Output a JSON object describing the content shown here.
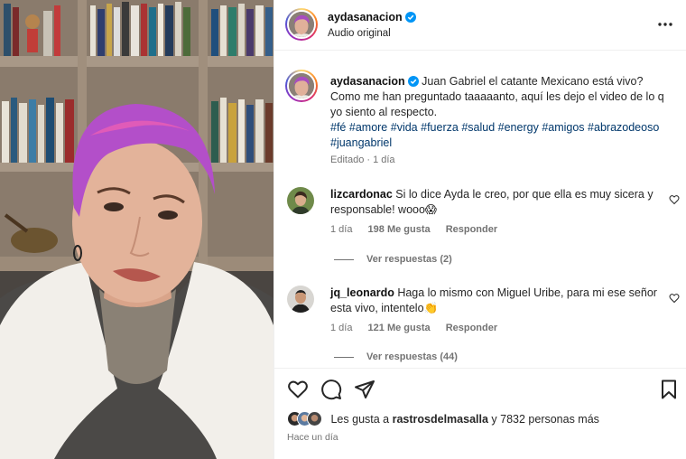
{
  "header": {
    "username": "aydasanacion",
    "audio_label": "Audio original",
    "icons": {
      "verified": "verified-badge-icon",
      "more": "more-options-icon"
    }
  },
  "caption": {
    "username": "aydasanacion",
    "text": "Juan Gabriel el catante Mexicano está vivo? Como me han preguntado taaaaanto, aquí les dejo el video de lo q yo siento al respecto.",
    "hashtags": [
      "#fé",
      "#amore",
      "#vida",
      "#fuerza",
      "#salud",
      "#energy",
      "#amigos",
      "#abrazodeoso",
      "#juangabriel"
    ],
    "meta": "Editado · 1 día"
  },
  "comments": [
    {
      "username": "lizcardonac",
      "text": "Si lo dice Ayda le creo, por que ella es muy sicera y responsable! wooo😱",
      "time": "1 día",
      "likes": "198 Me gusta",
      "reply_label": "Responder",
      "view_replies": "Ver respuestas (2)"
    },
    {
      "username": "jq_leonardo",
      "text": "Haga lo mismo con Miguel Uribe, para mi ese señor esta vivo, intentelo👏",
      "time": "1 día",
      "likes": "121 Me gusta",
      "reply_label": "Responder",
      "view_replies": "Ver respuestas (44)"
    }
  ],
  "actions": {
    "icons": [
      "heart-icon",
      "comment-icon",
      "share-icon",
      "bookmark-icon"
    ]
  },
  "likes_summary": {
    "prefix": "Les gusta a",
    "user": "rastrosdelmasalla",
    "suffix": "y 7832 personas más"
  },
  "time_ago": "Hace un día",
  "colors": {
    "link": "#00376b",
    "verified": "#0095f6",
    "secondary_text": "#737373",
    "divider": "#efefef"
  }
}
